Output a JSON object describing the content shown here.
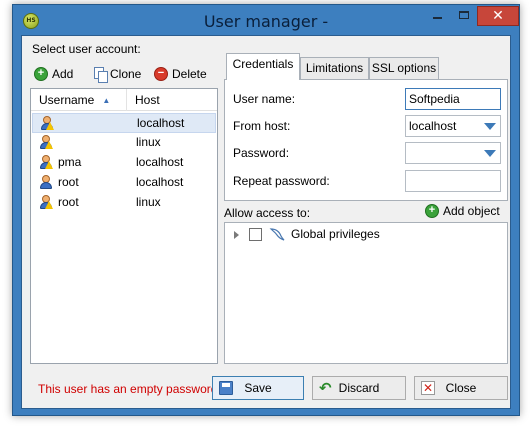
{
  "window": {
    "title": "User manager -",
    "app_icon_text": "HS"
  },
  "left_panel": {
    "select_label": "Select user account:",
    "toolbar": {
      "add_label": "Add",
      "clone_label": "Clone",
      "delete_label": "Delete"
    },
    "columns": [
      "Username",
      "Host"
    ],
    "rows": [
      {
        "username": "",
        "host": "localhost",
        "selected": true
      },
      {
        "username": "",
        "host": "linux",
        "selected": false
      },
      {
        "username": "pma",
        "host": "localhost",
        "selected": false
      },
      {
        "username": "root",
        "host": "localhost",
        "selected": false
      },
      {
        "username": "root",
        "host": "linux",
        "selected": false
      }
    ]
  },
  "tabs": [
    "Credentials",
    "Limitations",
    "SSL options"
  ],
  "credentials": {
    "user_name_label": "User name:",
    "user_name_value": "Softpedia",
    "from_host_label": "From host:",
    "from_host_value": "localhost",
    "password_label": "Password:",
    "password_value": "",
    "repeat_password_label": "Repeat password:",
    "repeat_password_value": ""
  },
  "access": {
    "label": "Allow access to:",
    "add_object_label": "Add object",
    "tree_items": [
      "Global privileges"
    ]
  },
  "footer": {
    "warning": "This user has an empty password.",
    "save_label": "Save",
    "discard_label": "Discard",
    "close_label": "Close"
  },
  "colors": {
    "title_bar": "#3d7fbf",
    "warning": "#d00000",
    "close_button": "#c7463a"
  }
}
